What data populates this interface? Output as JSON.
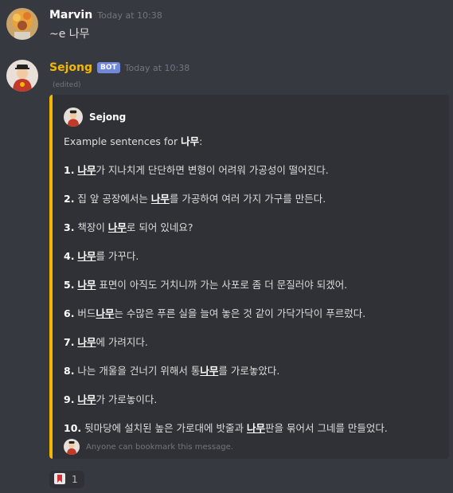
{
  "messages": [
    {
      "author": "Marvin",
      "timestamp": "Today at 10:38",
      "text": "~e 나무",
      "author_color": "#ffffff"
    },
    {
      "author": "Sejong",
      "badge": "BOT",
      "timestamp": "Today at 10:38",
      "edited": "(edited)",
      "author_color": "#f5b800"
    }
  ],
  "embed": {
    "author": "Sejong",
    "description_prefix": "Example sentences for ",
    "description_word": "나무",
    "description_suffix": ":",
    "accent_color": "#f5b800",
    "sentences": [
      {
        "num": "1.",
        "before": " ",
        "word": "나무",
        "after": "가 지나치게 단단하면 변형이 어려워 가공성이 떨어진다."
      },
      {
        "num": "2.",
        "before": " 집 앞 공장에서는 ",
        "word": "나무",
        "after": "를 가공하여 여러 가지 가구를 만든다."
      },
      {
        "num": "3.",
        "before": " 책장이 ",
        "word": "나무",
        "after": "로 되어 있네요?"
      },
      {
        "num": "4.",
        "before": " ",
        "word": "나무",
        "after": "를 가꾸다."
      },
      {
        "num": "5.",
        "before": " ",
        "word": "나무",
        "after": " 표면이 아직도 거치니까 가는 사포로 좀 더 문질러야 되겠어."
      },
      {
        "num": "6.",
        "before": " 버드",
        "word": "나무",
        "after": "는 수많은 푸른 실을 늘여 놓은 것 같이 가닥가닥이 푸르렀다."
      },
      {
        "num": "7.",
        "before": " ",
        "word": "나무",
        "after": "에 가려지다."
      },
      {
        "num": "8.",
        "before": " 나는 개울을 건너기 위해서 통",
        "word": "나무",
        "after": "를 가로놓았다."
      },
      {
        "num": "9.",
        "before": " ",
        "word": "나무",
        "after": "가 가로놓이다."
      },
      {
        "num": "10.",
        "before": " 뒷마당에 설치된 높은 가로대에 밧줄과 ",
        "word": "나무",
        "after": "판을 묶어서 그네를 만들었다."
      }
    ],
    "footer": "Anyone can bookmark this message."
  },
  "reaction": {
    "icon": "bookmark-icon",
    "count": "1"
  }
}
